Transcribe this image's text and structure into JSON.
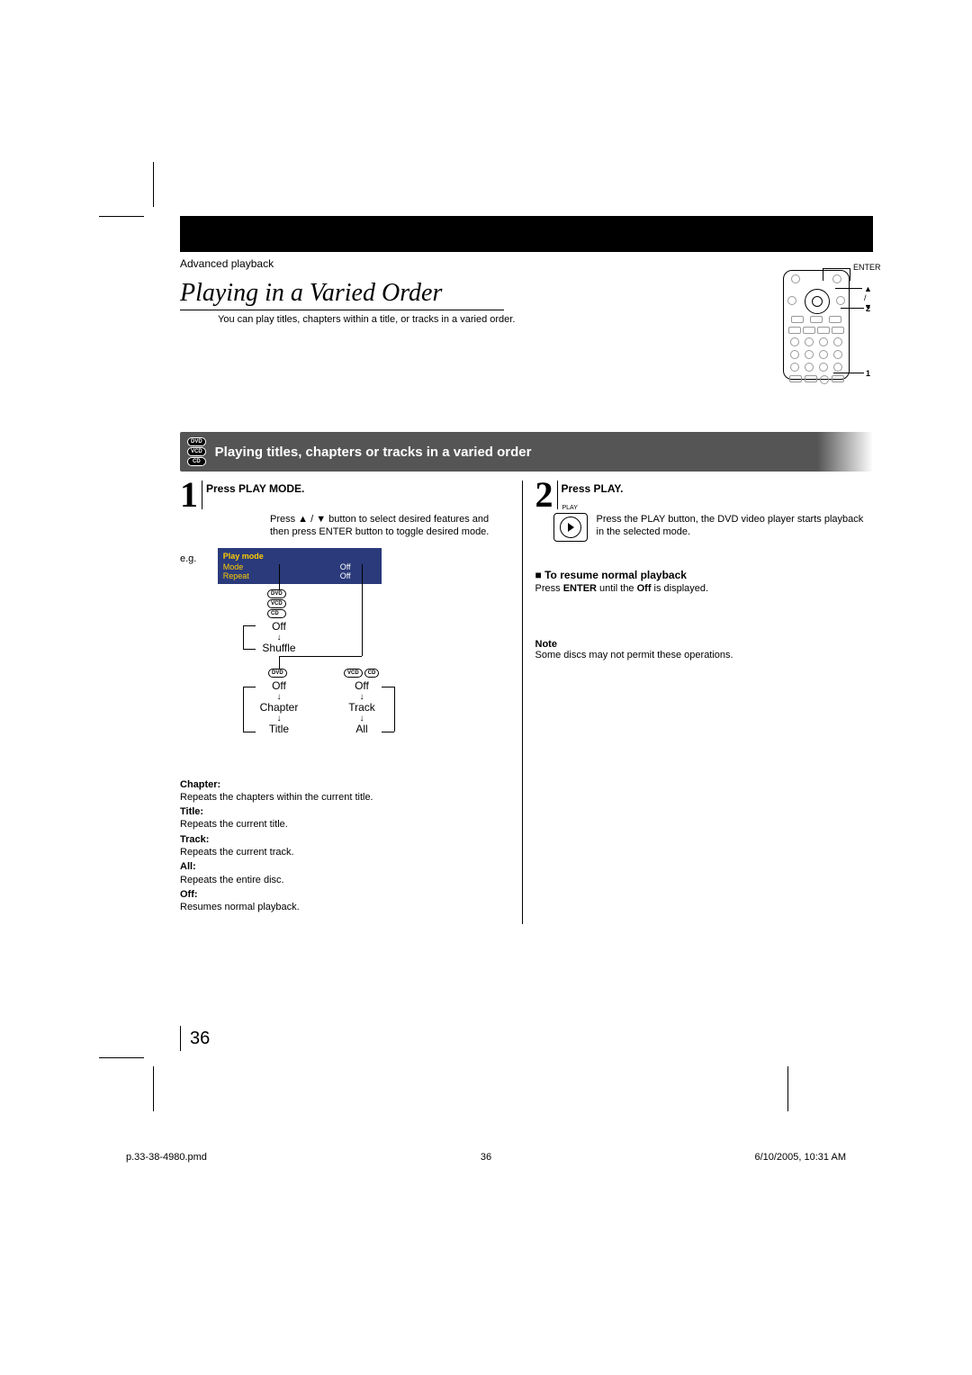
{
  "header": {
    "section": "Advanced playback",
    "title": "Playing in a Varied Order",
    "subtitle": "You can play titles, chapters within a title, or tracks in a varied order."
  },
  "remote": {
    "enter_label": "ENTER",
    "arrows_label": "▲ / ▼",
    "callout_2": "2",
    "callout_1": "1"
  },
  "subsection": {
    "badges": [
      "DVD",
      "VCD",
      "CD"
    ],
    "title": "Playing titles, chapters or tracks in a varied order"
  },
  "step1": {
    "num": "1",
    "title": "Press PLAY MODE.",
    "body": "Press ▲ / ▼ button to select desired features and then press ENTER button to toggle desired mode.",
    "eg": "e.g.",
    "osd": {
      "title": "Play mode",
      "rows": [
        {
          "k": "Mode",
          "v": "Off"
        },
        {
          "k": "Repeat",
          "v": "Off"
        }
      ]
    },
    "mode_tree": {
      "top_badges": [
        "DVD",
        "VCD",
        "CD"
      ],
      "top_off": "Off",
      "top_shuffle": "Shuffle",
      "dvd_badge": "DVD",
      "vcd_badges": [
        "VCD",
        "CD"
      ],
      "left_seq": [
        "Off",
        "Chapter",
        "Title"
      ],
      "right_seq": [
        "Off",
        "Track",
        "All"
      ]
    },
    "defs": [
      {
        "term": "Chapter:",
        "desc": "Repeats the chapters within the current title."
      },
      {
        "term": "Title:",
        "desc": "Repeats the current title."
      },
      {
        "term": "Track:",
        "desc": "Repeats the current track."
      },
      {
        "term": "All:",
        "desc": "Repeats the entire disc."
      },
      {
        "term": "Off:",
        "desc": "Resumes normal playback."
      }
    ]
  },
  "step2": {
    "num": "2",
    "title": "Press PLAY.",
    "play_label": "PLAY",
    "body": "Press the PLAY button, the DVD video player starts playback in the selected mode.",
    "resume_head": "To resume normal playback",
    "resume_body_pre": "Press ",
    "resume_enter": "ENTER",
    "resume_body_mid": " until the ",
    "resume_off": "Off",
    "resume_body_post": " is displayed.",
    "note_head": "Note",
    "note_body": "Some discs may not permit these operations."
  },
  "page_num": "36",
  "footer": {
    "filename": "p.33-38-4980.pmd",
    "page": "36",
    "datetime": "6/10/2005, 10:31 AM"
  }
}
